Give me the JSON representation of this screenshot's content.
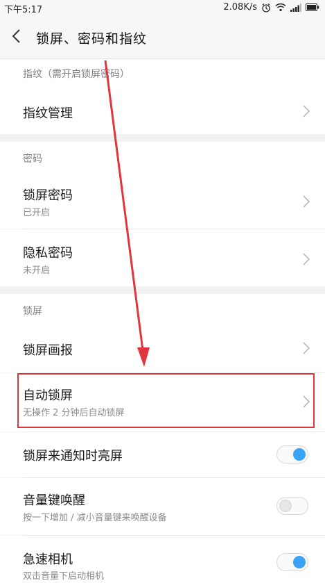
{
  "status_bar": {
    "time": "下午5:17",
    "network_speed": "2.08K/s",
    "icons": [
      "alarm-icon",
      "wifi-icon",
      "signal-icon",
      "battery-icon"
    ]
  },
  "header": {
    "back_icon": "back-arrow-icon",
    "title": "锁屏、密码和指纹"
  },
  "sections": {
    "fingerprint": {
      "header": "指纹（需开启锁屏密码）",
      "items": [
        {
          "title": "指纹管理"
        }
      ]
    },
    "password": {
      "header": "密码",
      "items": [
        {
          "title": "锁屏密码",
          "subtitle": "已开启"
        },
        {
          "title": "隐私密码",
          "subtitle": "未开启"
        }
      ]
    },
    "lockscreen": {
      "header": "锁屏",
      "items": [
        {
          "title": "锁屏画报"
        },
        {
          "title": "自动锁屏",
          "subtitle": "无操作 2 分钟后自动锁屏"
        },
        {
          "title": "锁屏来通知时亮屏",
          "toggle": true
        },
        {
          "title": "音量键唤醒",
          "subtitle": "按一下增加 / 减小音量键来唤醒设备",
          "toggle": false
        },
        {
          "title": "急速相机",
          "subtitle": "双击音量下启动相机",
          "toggle": true
        }
      ]
    }
  },
  "annotation": {
    "highlight_color": "#e0353c",
    "arrow_color": "#e0353c"
  },
  "colors": {
    "toggle_on": "#3aa3f5",
    "background": "#f5f5f5"
  }
}
